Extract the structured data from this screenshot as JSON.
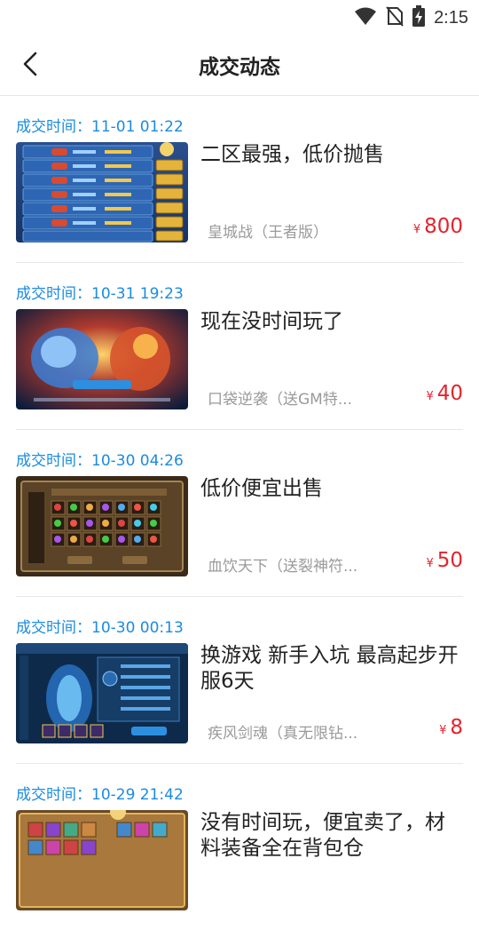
{
  "status_bar": {
    "time": "2:15",
    "icons": [
      "wifi-icon",
      "no-sim-icon",
      "battery-charging-icon"
    ]
  },
  "header": {
    "title": "成交动态",
    "back_icon": "chevron-left-icon"
  },
  "colors": {
    "accent": "#1a8be0",
    "price": "#e4232c",
    "title": "#222222",
    "muted": "#9a9a9a"
  },
  "transactions": [
    {
      "time": "成交时间：11-01 01:22",
      "title": "二区最强，低价抛售",
      "game": "皇城战（王者版）",
      "currency": "¥",
      "price": "800"
    },
    {
      "time": "成交时间：10-31 19:23",
      "title": "现在没时间玩了",
      "game": "口袋逆袭（送GM特...",
      "currency": "¥",
      "price": "40"
    },
    {
      "time": "成交时间：10-30 04:26",
      "title": "低价便宜出售",
      "game": "血饮天下（送裂神符...",
      "currency": "¥",
      "price": "50"
    },
    {
      "time": "成交时间：10-30 00:13",
      "title": "换游戏 新手入坑 最高起步开服6天",
      "game": "疾风剑魂（真无限钻...",
      "currency": "¥",
      "price": "8"
    },
    {
      "time": "成交时间：10-29 21:42",
      "title": "没有时间玩，便宜卖了，材料装备全在背包仓"
    }
  ]
}
